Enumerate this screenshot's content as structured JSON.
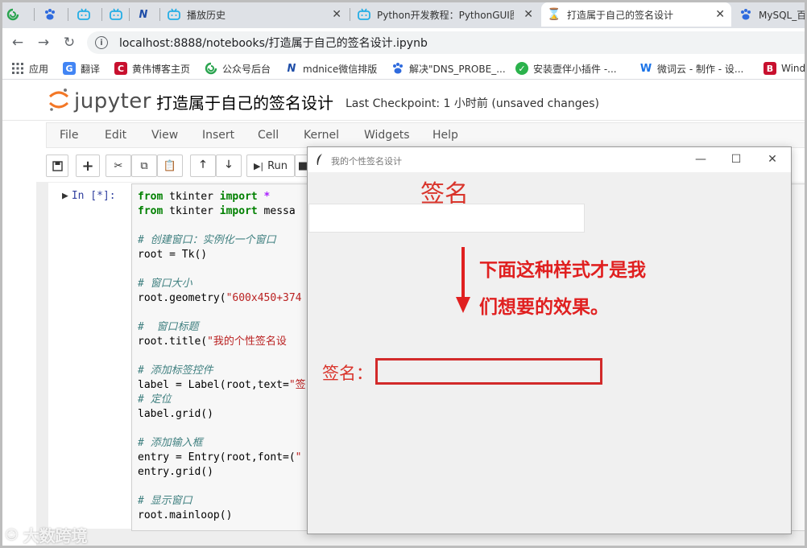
{
  "browser": {
    "tabs": [
      {
        "title": "",
        "icon": "refresh-green-icon"
      },
      {
        "title": "",
        "icon": "baidu-paw-icon"
      },
      {
        "title": "",
        "icon": "bilibili-icon"
      },
      {
        "title": "",
        "icon": "bilibili-icon"
      },
      {
        "title": "",
        "icon": "mdnice-icon"
      },
      {
        "title": "播放历史",
        "icon": "bilibili-icon"
      },
      {
        "title": "Python开发教程：PythonGUI图",
        "icon": "bilibili-icon"
      },
      {
        "title": "打造属于自己的签名设计",
        "icon": "hourglass-icon"
      },
      {
        "title": "MySQL_百",
        "icon": "baidu-paw-icon"
      }
    ],
    "url": "localhost:8888/notebooks/打造属于自己的签名设计.ipynb",
    "bookmarks": [
      "应用",
      "翻译",
      "黄伟博客主页",
      "公众号后台",
      "mdnice微信排版",
      "解决\"DNS_PROBE_...",
      "安装壹伴小插件 -...",
      "微词云 - 制作 - 设...",
      "Wind"
    ],
    "accent": "#1a73e8"
  },
  "jupyter": {
    "logo_text": "jupyter",
    "notebook_name": "打造属于自己的签名设计",
    "checkpoint": "Last Checkpoint: 1 小时前   (unsaved changes)",
    "menus": [
      "File",
      "Edit",
      "View",
      "Insert",
      "Cell",
      "Kernel",
      "Widgets",
      "Help"
    ],
    "toolbar": {
      "run_label": "Run"
    },
    "prompt": "In  [*]:",
    "code": {
      "l1a": "from",
      "l1b": " tkinter ",
      "l1c": "import",
      "l1d": " *",
      "l2a": "from",
      "l2b": " tkinter ",
      "l2c": "import",
      "l2d": " messa",
      "c1": "# 创建窗口：实例化一个窗口",
      "l4": "root = Tk()",
      "c2": "# 窗口大小",
      "l6a": "root.geometry(",
      "l6b": "\"600x450+374",
      "c3": "#  窗口标题",
      "l8a": "root.title(",
      "l8b": "\"我的个性签名设",
      "c4": "# 添加标签控件",
      "l10a": "label = Label(root,text=",
      "l10b": "\"签",
      "c5": "# 定位",
      "l11": "label.grid()",
      "c6": "# 添加输入框",
      "l13a": "entry = Entry(root,font=(",
      "l13b": "\"",
      "l14": "entry.grid()",
      "c7": "# 显示窗口",
      "l16": "root.mainloop()"
    }
  },
  "tk_window": {
    "title": "我的个性签名设计",
    "label": "签名",
    "annotation_line1": "下面这种样式才是我",
    "annotation_line2": "们想要的效果。",
    "sig_label": "签名：",
    "colors": {
      "label_red": "#d9342b",
      "annotation_red": "#e02020",
      "box_red": "#d22a2a"
    }
  },
  "watermark": "大数跨境"
}
